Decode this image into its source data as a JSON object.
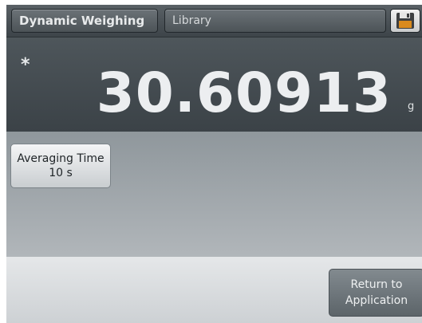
{
  "header": {
    "application_label": "Dynamic Weighing",
    "library_label": "Library",
    "save_icon": "floppy-disk-icon"
  },
  "readout": {
    "stable_indicator": "*",
    "weight": "30.60913",
    "unit": "g"
  },
  "parameters": [
    {
      "label": "Averaging Time",
      "value": "10 s"
    }
  ],
  "footer": {
    "return_line1": "Return to",
    "return_line2": "Application"
  }
}
